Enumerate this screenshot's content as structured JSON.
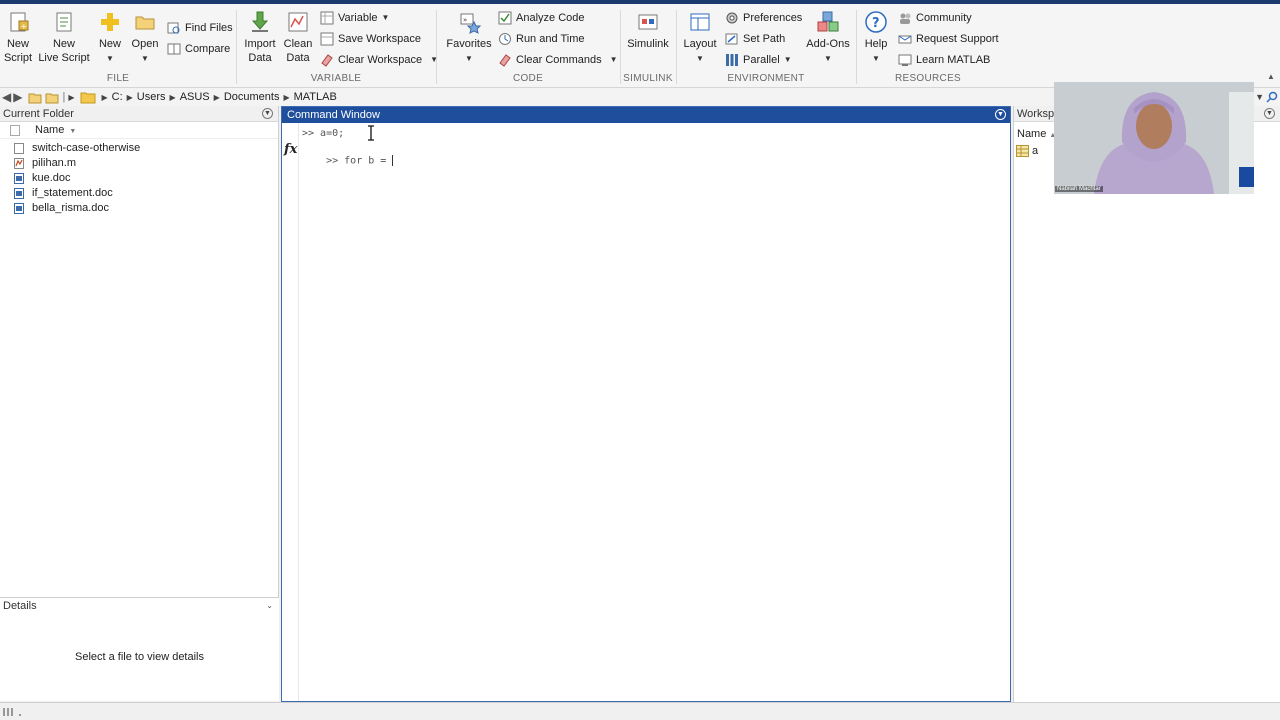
{
  "toolstrip": {
    "file": {
      "label": "FILE",
      "new_script": [
        "New",
        "Script"
      ],
      "new_live_script": [
        "New",
        "Live Script"
      ],
      "new": "New",
      "open": "Open",
      "find_files": "Find Files",
      "compare": "Compare"
    },
    "variable": {
      "label": "VARIABLE",
      "import_data": [
        "Import",
        "Data"
      ],
      "clean_data": [
        "Clean",
        "Data"
      ],
      "variable": "Variable",
      "save_workspace": "Save Workspace",
      "clear_workspace": "Clear Workspace"
    },
    "code": {
      "label": "CODE",
      "favorites": "Favorites",
      "analyze_code": "Analyze Code",
      "run_and_time": "Run and Time",
      "clear_commands": "Clear Commands"
    },
    "simulink": {
      "label": "SIMULINK",
      "simulink": "Simulink"
    },
    "environment": {
      "label": "ENVIRONMENT",
      "layout": "Layout",
      "preferences": "Preferences",
      "set_path": "Set Path",
      "parallel": "Parallel",
      "add_ons": "Add-Ons"
    },
    "resources": {
      "label": "RESOURCES",
      "help": "Help",
      "community": "Community",
      "request_support": "Request Support",
      "learn_matlab": "Learn MATLAB"
    }
  },
  "address_bar": {
    "path": [
      "C:",
      "Users",
      "ASUS",
      "Documents",
      "MATLAB"
    ]
  },
  "current_folder": {
    "title": "Current Folder",
    "column_name": "Name",
    "files": [
      {
        "name": "switch-case-otherwise",
        "icon": "file-icon"
      },
      {
        "name": "pilihan.m",
        "icon": "matlab-file-icon"
      },
      {
        "name": "kue.doc",
        "icon": "word-doc-icon"
      },
      {
        "name": "if_statement.doc",
        "icon": "word-doc-icon"
      },
      {
        "name": "bella_risma.doc",
        "icon": "word-doc-icon"
      }
    ]
  },
  "details": {
    "title": "Details",
    "message": "Select a file to view details"
  },
  "command_window": {
    "title": "Command Window",
    "lines": [
      ">> a=0;",
      ">> for b = "
    ],
    "fx_label": "fx"
  },
  "workspace": {
    "title": "Worksp",
    "column_name": "Name",
    "variables": [
      "a"
    ]
  },
  "webcam": {
    "name_tag": "Nabilah Machtar"
  },
  "colors": {
    "title_active": "#1f4f9c",
    "topbar": "#1d3a6e"
  }
}
